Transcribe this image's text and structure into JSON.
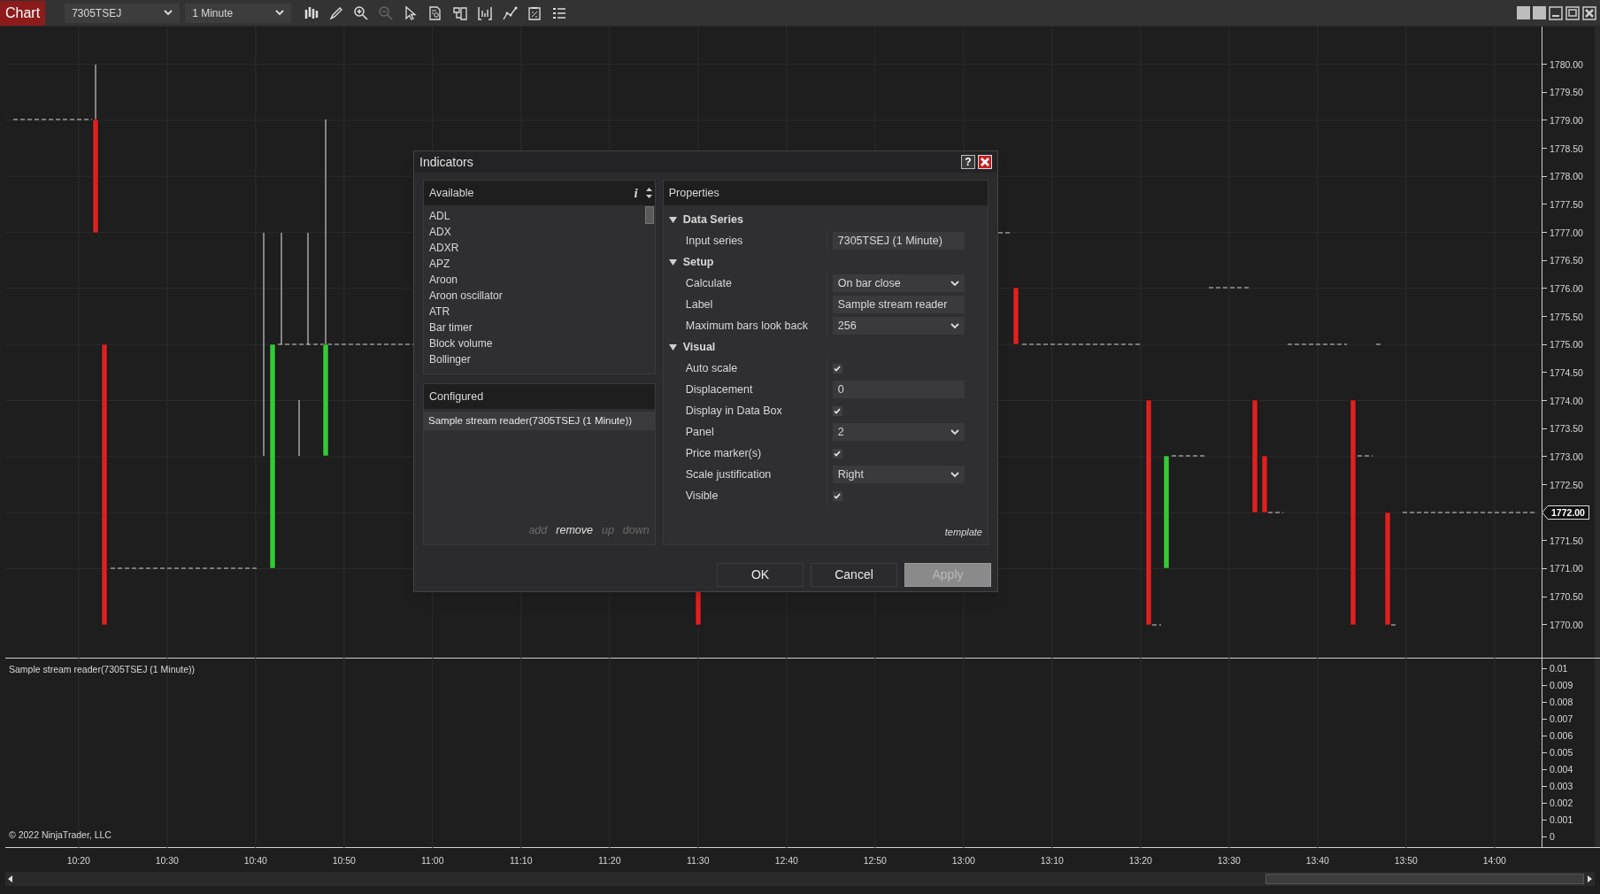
{
  "toolbar": {
    "app_button": "Chart",
    "instrument": "7305TSEJ",
    "interval": "1 Minute"
  },
  "price_axis": {
    "labels": [
      "1780.00",
      "1779.50",
      "1779.00",
      "1778.50",
      "1778.00",
      "1777.50",
      "1777.00",
      "1776.50",
      "1776.00",
      "1775.50",
      "1775.00",
      "1774.50",
      "1774.00",
      "1773.50",
      "1773.00",
      "1772.50",
      "1771.50",
      "1771.00",
      "1770.50",
      "1770.00"
    ],
    "current_price": "1772.00"
  },
  "lower_panel": {
    "indicator_label": "Sample stream reader(7305TSEJ (1 Minute))",
    "copyright": "© 2022 NinjaTrader, LLC",
    "axis_labels": [
      "0.01",
      "0.009",
      "0.008",
      "0.007",
      "0.006",
      "0.005",
      "0.004",
      "0.003",
      "0.002",
      "0.001",
      "0"
    ]
  },
  "time_axis": {
    "labels": [
      "10:20",
      "10:30",
      "10:40",
      "10:50",
      "11:00",
      "11:10",
      "11:20",
      "11:30",
      "12:40",
      "12:50",
      "13:00",
      "13:10",
      "13:20",
      "13:30",
      "13:40",
      "13:50",
      "14:00"
    ]
  },
  "dialog": {
    "title": "Indicators",
    "help": "?",
    "available": {
      "header": "Available",
      "info": "i",
      "items": [
        "ADL",
        "ADX",
        "ADXR",
        "APZ",
        "Aroon",
        "Aroon oscillator",
        "ATR",
        "Bar timer",
        "Block volume",
        "Bollinger"
      ]
    },
    "configured": {
      "header": "Configured",
      "items": [
        {
          "label": "Sample stream reader(7305TSEJ (1 Minute))",
          "selected": true
        }
      ],
      "actions": [
        {
          "label": "add",
          "disabled": true
        },
        {
          "label": "remove",
          "disabled": false
        },
        {
          "label": "up",
          "disabled": true
        },
        {
          "label": "down",
          "disabled": true
        }
      ]
    },
    "properties": {
      "header": "Properties",
      "template": "template",
      "categories": [
        {
          "name": "Data Series",
          "expanded": true,
          "rows": [
            {
              "label": "Input series",
              "kind": "text",
              "value": "7305TSEJ (1 Minute)"
            }
          ]
        },
        {
          "name": "Setup",
          "expanded": true,
          "rows": [
            {
              "label": "Calculate",
              "kind": "dropdown",
              "value": "On bar close"
            },
            {
              "label": "Label",
              "kind": "text",
              "value": "Sample stream reader"
            },
            {
              "label": "Maximum bars look back",
              "kind": "dropdown",
              "value": "256"
            }
          ]
        },
        {
          "name": "Visual",
          "expanded": true,
          "rows": [
            {
              "label": "Auto scale",
              "kind": "checkbox",
              "checked": true
            },
            {
              "label": "Displacement",
              "kind": "text",
              "value": "0"
            },
            {
              "label": "Display in Data Box",
              "kind": "checkbox",
              "checked": true
            },
            {
              "label": "Panel",
              "kind": "dropdown",
              "value": "2"
            },
            {
              "label": "Price marker(s)",
              "kind": "checkbox",
              "checked": true
            },
            {
              "label": "Scale justification",
              "kind": "dropdown",
              "value": "Right"
            },
            {
              "label": "Visible",
              "kind": "checkbox",
              "checked": true
            }
          ]
        }
      ]
    },
    "buttons": [
      {
        "label": "OK",
        "disabled": false
      },
      {
        "label": "Cancel",
        "disabled": false
      },
      {
        "label": "Apply",
        "disabled": true
      }
    ]
  }
}
